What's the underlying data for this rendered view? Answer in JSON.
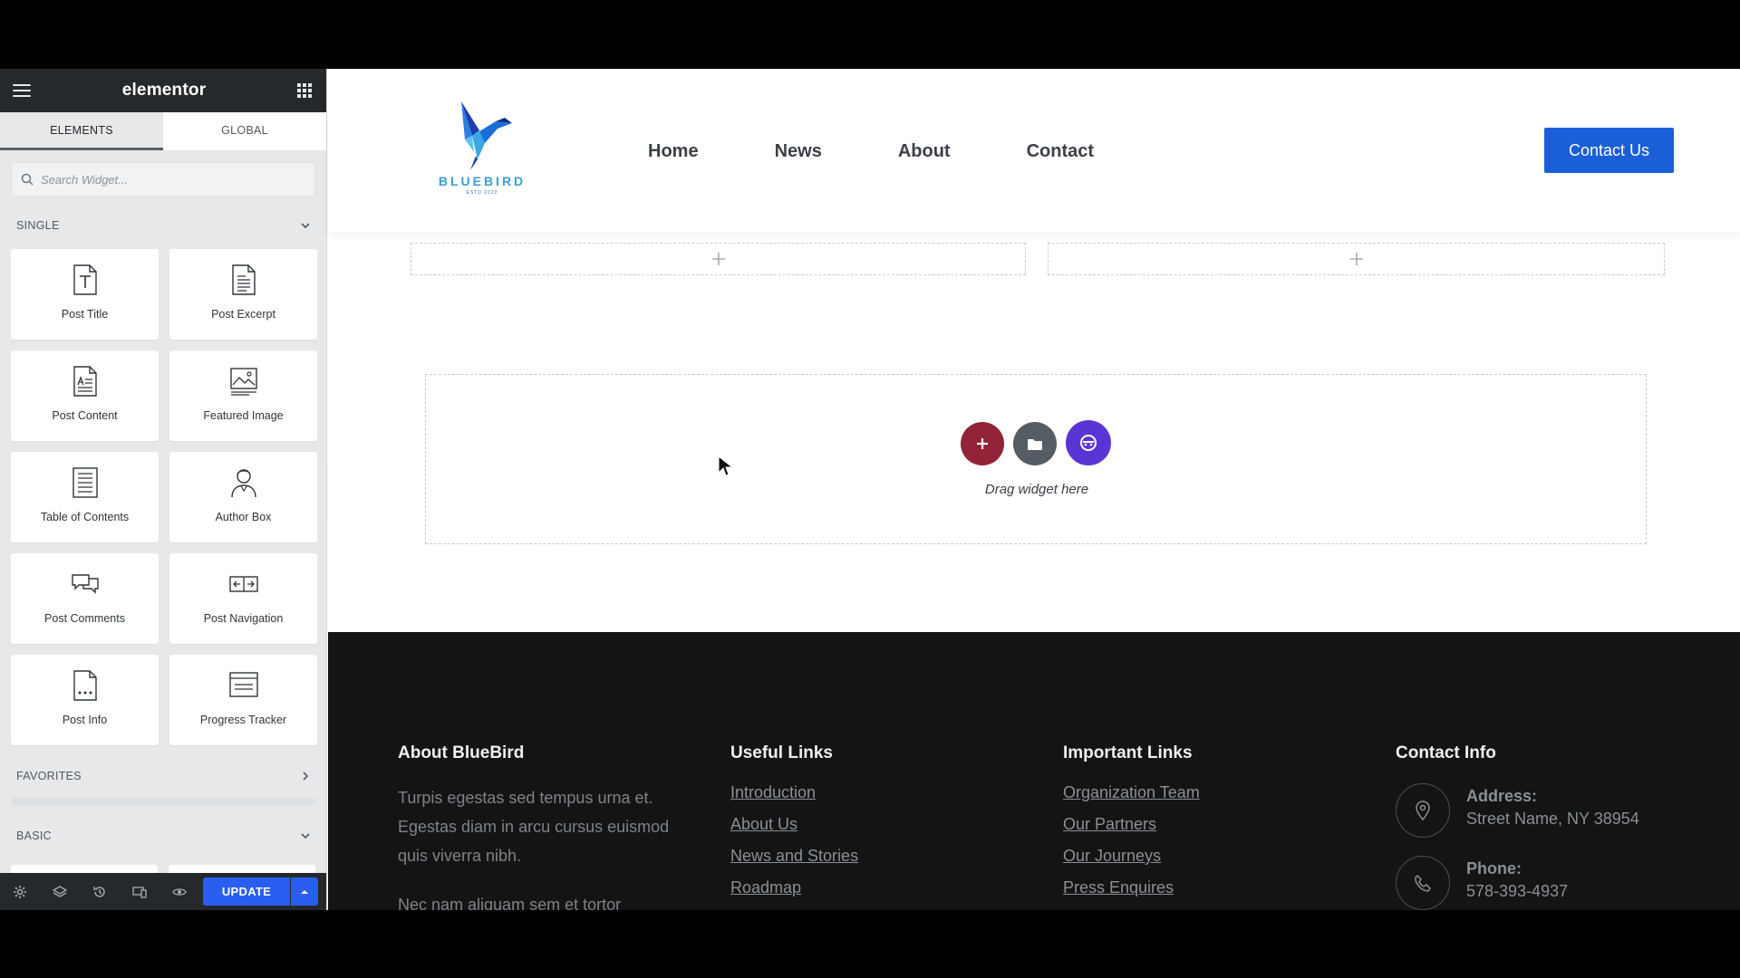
{
  "panel": {
    "brand": "elementor",
    "tabs": [
      {
        "label": "ELEMENTS"
      },
      {
        "label": "GLOBAL"
      }
    ],
    "search_placeholder": "Search Widget...",
    "categories": {
      "single": "SINGLE",
      "favorites": "FAVORITES",
      "basic": "BASIC"
    },
    "widgets": [
      {
        "label": "Post Title",
        "icon": "post-title-icon"
      },
      {
        "label": "Post Excerpt",
        "icon": "post-excerpt-icon"
      },
      {
        "label": "Post Content",
        "icon": "post-content-icon"
      },
      {
        "label": "Featured Image",
        "icon": "featured-image-icon"
      },
      {
        "label": "Table of Contents",
        "icon": "table-of-contents-icon"
      },
      {
        "label": "Author Box",
        "icon": "author-box-icon"
      },
      {
        "label": "Post Comments",
        "icon": "post-comments-icon"
      },
      {
        "label": "Post Navigation",
        "icon": "post-navigation-icon"
      },
      {
        "label": "Post Info",
        "icon": "post-info-icon"
      },
      {
        "label": "Progress Tracker",
        "icon": "progress-tracker-icon"
      }
    ],
    "update_label": "UPDATE"
  },
  "site": {
    "logo": {
      "word": "BLUEBIRD",
      "sub": "ESTD 2022"
    },
    "nav": [
      "Home",
      "News",
      "About",
      "Contact"
    ],
    "cta_label": "Contact Us",
    "drop_text": "Drag widget here",
    "footer": {
      "about": {
        "title": "About BlueBird",
        "text": "Turpis egestas sed tempus urna et. Egestas diam in arcu cursus euismod quis viverra nibh.",
        "text2": "Nec nam aliquam sem et tortor"
      },
      "useful": {
        "title": "Useful Links",
        "links": [
          "Introduction",
          "About Us",
          "News and Stories",
          "Roadmap"
        ]
      },
      "important": {
        "title": "Important Links",
        "links": [
          "Organization Team",
          "Our Partners",
          "Our Journeys",
          "Press Enquires"
        ]
      },
      "contact": {
        "title": "Contact Info",
        "address_label": "Address:",
        "address_value": "Street Name, NY 38954",
        "phone_label": "Phone:",
        "phone_value": "578-393-4937"
      }
    }
  },
  "colors": {
    "panel_dark": "#26292c",
    "accent_blue": "#2a5ef0",
    "add_button": "#922238",
    "ai_button": "#5a35d6"
  }
}
